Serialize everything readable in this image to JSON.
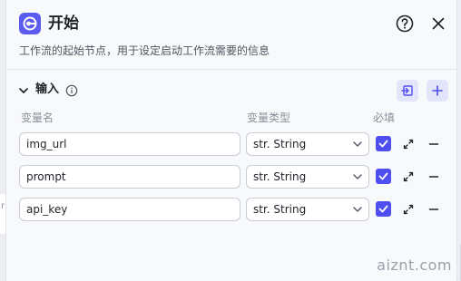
{
  "header": {
    "title": "开始",
    "description": "工作流的起始节点，用于设定启动工作流需要的信息",
    "logo_icon": "start-node-icon",
    "help_icon": "question-circle-icon",
    "close_icon": "close-icon"
  },
  "section": {
    "title": "输入",
    "info_icon": "info-icon",
    "import_icon": "import-icon",
    "add_icon": "plus-icon"
  },
  "columns": {
    "name": "变量名",
    "type": "变量类型",
    "required": "必填"
  },
  "variables": [
    {
      "name": "img_url",
      "type": "str. String",
      "required": true
    },
    {
      "name": "prompt",
      "type": "str. String",
      "required": true
    },
    {
      "name": "api_key",
      "type": "str. String",
      "required": true
    }
  ],
  "background_fragment": "r",
  "watermark": "aiznt.com",
  "colors": {
    "accent": "#4f4ef0",
    "logo_bg": "#5b5bf0",
    "button_bg": "#e3e6fb"
  }
}
